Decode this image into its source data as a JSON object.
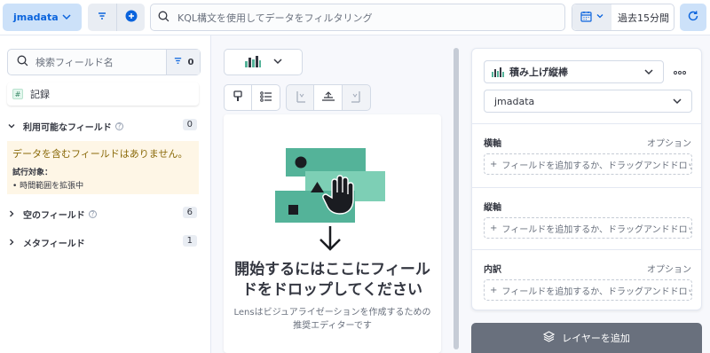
{
  "topbar": {
    "dataview_label": "jmadata",
    "query_placeholder": "KQL構文を使用してデータをフィルタリング",
    "date_label": "過去15分間"
  },
  "left": {
    "search_placeholder": "検索フィールド名",
    "filter_count": "0",
    "record_label": "記録",
    "available": {
      "label": "利用可能なフィールド",
      "count": "0"
    },
    "callout": {
      "title": "データを含むフィールドはありません。",
      "subtitle": "試行対象：",
      "item": "時間範囲を拡張中"
    },
    "empty": {
      "label": "空のフィールド",
      "count": "6"
    },
    "meta": {
      "label": "メタフィールド",
      "count": "1"
    }
  },
  "workspace": {
    "drop_title_line1": "開始するにはここにフィール",
    "drop_title_line2": "ドをドロップしてください",
    "drop_sub_line1": "Lensはビジュアライゼーションを作成するための",
    "drop_sub_line2": "推奨エディターです"
  },
  "config": {
    "chart_type": "積み上げ縦棒",
    "dataview": "jmadata",
    "horizontal": {
      "label": "横軸",
      "optional": "オプション",
      "add": "フィールドを追加するか、ドラッグアンドドロップ"
    },
    "vertical": {
      "label": "縦軸",
      "add": "フィールドを追加するか、ドラッグアンドドロップ"
    },
    "breakdown": {
      "label": "内訳",
      "optional": "オプション",
      "add": "フィールドを追加するか、ドラッグアンドドロップ"
    },
    "add_layer": "レイヤーを追加"
  },
  "colors": {
    "primary": "#0b64dd",
    "illustration": "#54b399",
    "callout_bg": "#fef6e6"
  }
}
